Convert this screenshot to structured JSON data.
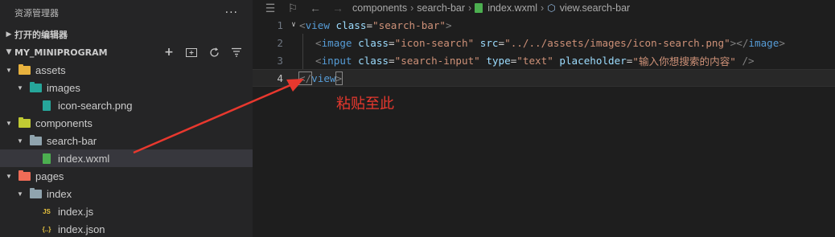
{
  "sidebar": {
    "title": "资源管理器",
    "more_label": "···",
    "open_editors_label": "打开的编辑器",
    "project_label": "MY_MINIPROGRAM",
    "tree": [
      {
        "label": "assets",
        "expanded": true,
        "depth": 0,
        "kind": "folder",
        "color": "#e8b23e"
      },
      {
        "label": "images",
        "expanded": true,
        "depth": 1,
        "kind": "folder",
        "color": "#26a69a"
      },
      {
        "label": "icon-search.png",
        "depth": 2,
        "kind": "image",
        "color": "#26a69a"
      },
      {
        "label": "components",
        "expanded": true,
        "depth": 0,
        "kind": "folder",
        "color": "#c0ca33"
      },
      {
        "label": "search-bar",
        "expanded": true,
        "depth": 1,
        "kind": "folder",
        "color": "#90a4ae"
      },
      {
        "label": "index.wxml",
        "depth": 2,
        "kind": "wxml",
        "color": "#4caf50",
        "selected": true
      },
      {
        "label": "pages",
        "expanded": true,
        "depth": 0,
        "kind": "folder",
        "color": "#ef6c57"
      },
      {
        "label": "index",
        "expanded": true,
        "depth": 1,
        "kind": "folder",
        "color": "#90a4ae"
      },
      {
        "label": "index.js",
        "depth": 2,
        "kind": "js",
        "color": "#e8c33e"
      },
      {
        "label": "index.json",
        "depth": 2,
        "kind": "json",
        "color": "#e8c33e"
      }
    ]
  },
  "editor": {
    "breadcrumbs": {
      "folder1": "components",
      "folder2": "search-bar",
      "file": "index.wxml",
      "symbol": "view.search-bar"
    },
    "lines": [
      {
        "number": "1",
        "fold": true,
        "indent": 0,
        "tokens": [
          {
            "t": "<",
            "c": "punct"
          },
          {
            "t": "view",
            "c": "tag"
          },
          {
            "t": " class",
            "c": "attr"
          },
          {
            "t": "=",
            "c": "plain"
          },
          {
            "t": "\"search-bar\"",
            "c": "str"
          },
          {
            "t": ">",
            "c": "punct"
          }
        ]
      },
      {
        "number": "2",
        "indent": 1,
        "tokens": [
          {
            "t": "<",
            "c": "punct"
          },
          {
            "t": "image",
            "c": "tag"
          },
          {
            "t": " class",
            "c": "attr"
          },
          {
            "t": "=",
            "c": "plain"
          },
          {
            "t": "\"icon-search\"",
            "c": "str"
          },
          {
            "t": " src",
            "c": "attr"
          },
          {
            "t": "=",
            "c": "plain"
          },
          {
            "t": "\"../../assets/images/icon-search.png\"",
            "c": "str"
          },
          {
            "t": "></",
            "c": "punct"
          },
          {
            "t": "image",
            "c": "tag"
          },
          {
            "t": ">",
            "c": "punct"
          }
        ]
      },
      {
        "number": "3",
        "indent": 1,
        "tokens": [
          {
            "t": "<",
            "c": "punct"
          },
          {
            "t": "input",
            "c": "tag"
          },
          {
            "t": " class",
            "c": "attr"
          },
          {
            "t": "=",
            "c": "plain"
          },
          {
            "t": "\"search-input\"",
            "c": "str"
          },
          {
            "t": " type",
            "c": "attr"
          },
          {
            "t": "=",
            "c": "plain"
          },
          {
            "t": "\"text\"",
            "c": "str"
          },
          {
            "t": " placeholder",
            "c": "attr"
          },
          {
            "t": "=",
            "c": "plain"
          },
          {
            "t": "\"输入你想搜索的内容\"",
            "c": "str"
          },
          {
            "t": " />",
            "c": "punct"
          }
        ]
      },
      {
        "number": "4",
        "indent": 0,
        "current": true,
        "tokens": [
          {
            "t": "</",
            "c": "punct"
          },
          {
            "t": "view",
            "c": "tag"
          },
          {
            "t": ">",
            "c": "punct"
          }
        ]
      }
    ]
  },
  "annotation": {
    "text": "粘贴至此",
    "color": "#e8382e"
  }
}
